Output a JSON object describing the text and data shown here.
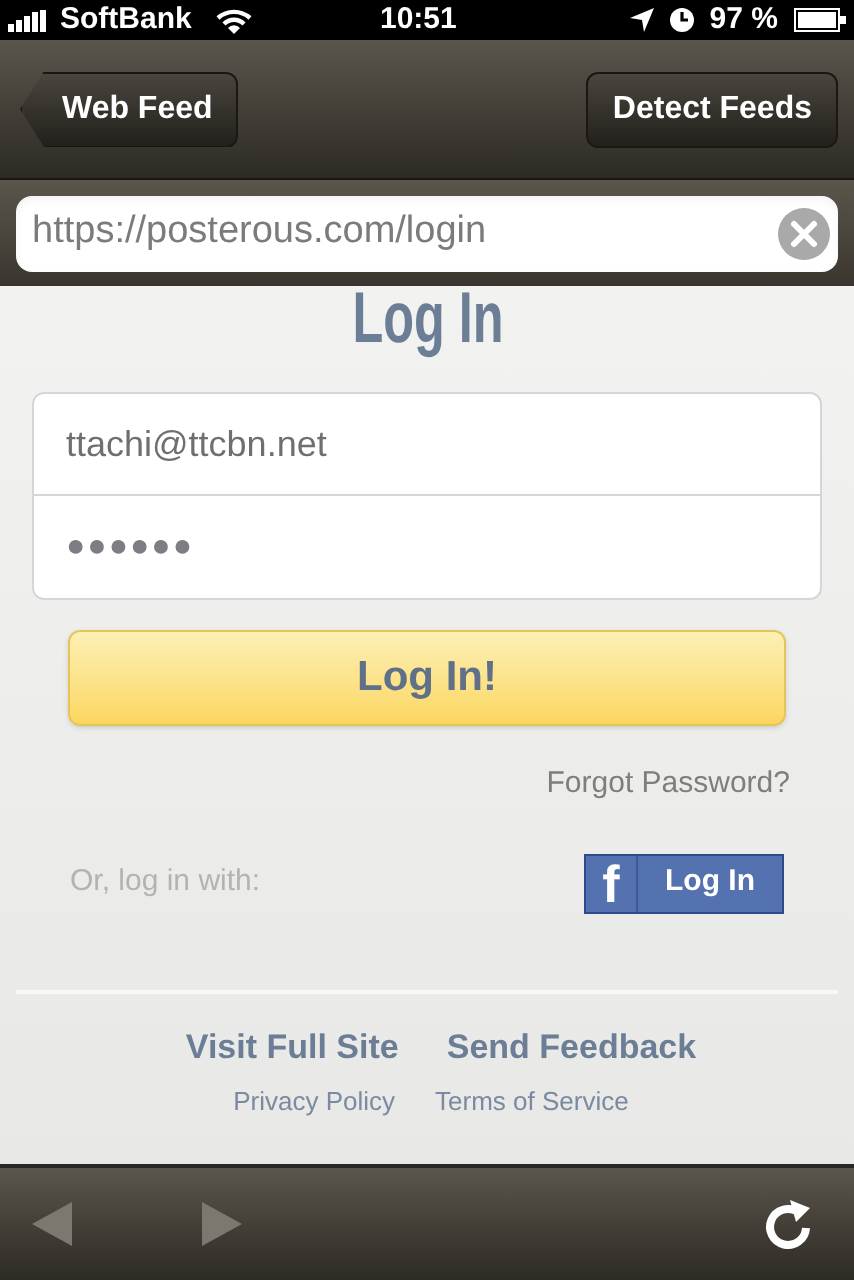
{
  "status_bar": {
    "carrier": "SoftBank",
    "time": "10:51",
    "battery": "97 %"
  },
  "nav_bar": {
    "back_button": "Web Feed",
    "action_button": "Detect Feeds"
  },
  "address_bar": {
    "value": "https://posterous.com/login"
  },
  "page": {
    "heading": "Log In",
    "email": {
      "value": "ttachi@ttcbn.net"
    },
    "password": {
      "value": "●●●●●●"
    },
    "login_button": "Log In!",
    "forgot_link": "Forgot Password?",
    "alt_login_label": "Or, log in with:",
    "facebook_button": {
      "logo": "f",
      "label": "Log In"
    },
    "footer_links": [
      "Visit Full Site",
      "Send Feedback"
    ],
    "legal_links": [
      "Privacy Policy",
      "Terms of Service"
    ]
  },
  "toolbar": {
    "back": {
      "disabled": true
    },
    "forward": {
      "disabled": true
    }
  }
}
